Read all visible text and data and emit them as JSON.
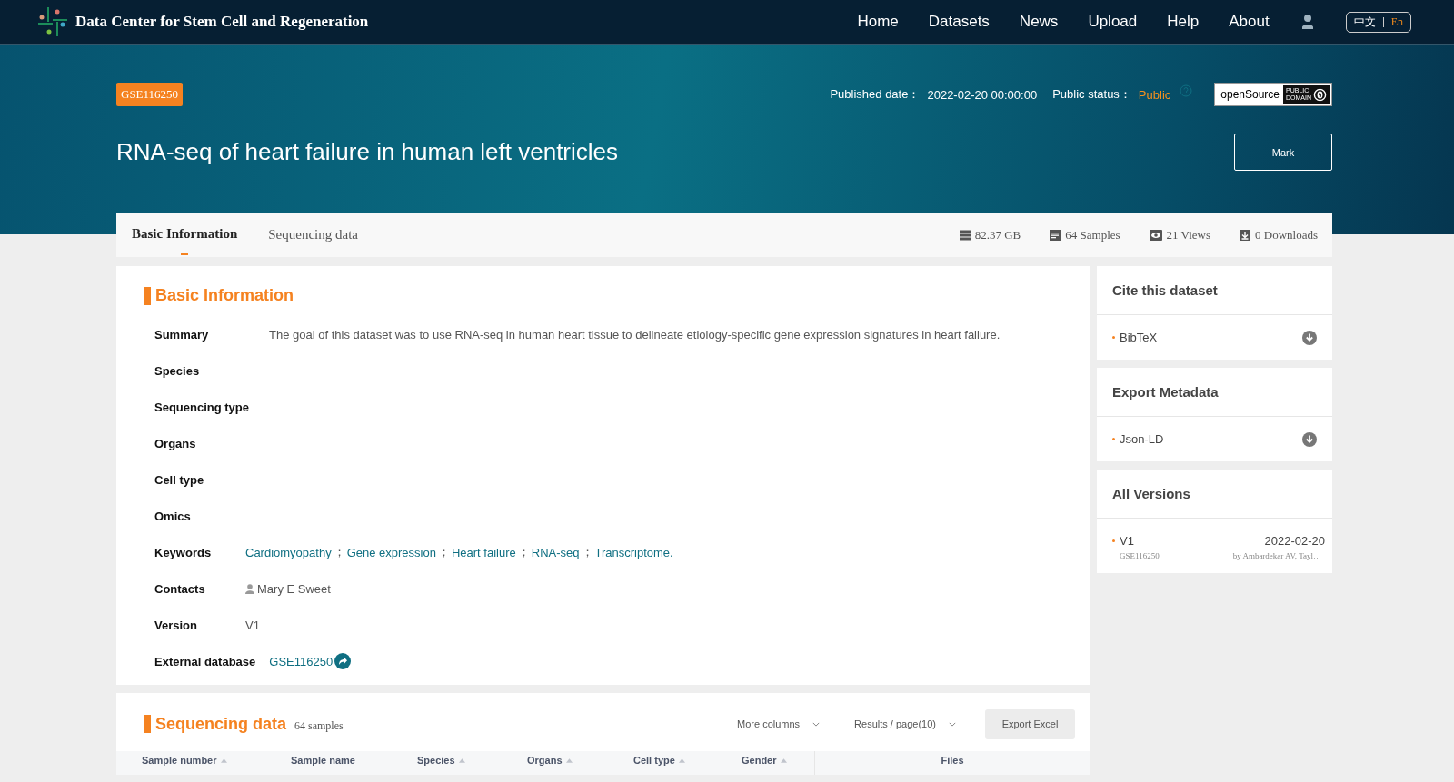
{
  "nav": {
    "site_title": "Data Center for Stem Cell and Regeneration",
    "links": [
      "Home",
      "Datasets",
      "News",
      "Upload",
      "Help",
      "About"
    ],
    "languages": [
      {
        "label": "中文",
        "selected": false
      },
      {
        "label": "En",
        "selected": true
      }
    ]
  },
  "header": {
    "accession": "GSE116250",
    "published_label": "Published date：",
    "published_date": "2022-02-20 00:00:00",
    "status_label": "Public status：",
    "status_value": "Public",
    "license": {
      "label": "openSource",
      "badge_lines": [
        "PUBLIC",
        "DOMAIN"
      ]
    },
    "title": "RNA-seq of heart failure in human left ventricles",
    "mark_button": "Mark"
  },
  "tabs": [
    {
      "label": "Basic Information",
      "selected": true
    },
    {
      "label": "Sequencing data",
      "selected": false
    }
  ],
  "stats": [
    {
      "kind": "size",
      "text": "82.37 GB"
    },
    {
      "kind": "samples",
      "text": "64 Samples"
    },
    {
      "kind": "views",
      "text": "21 Views"
    },
    {
      "kind": "downloads",
      "text": "0 Downloads"
    }
  ],
  "basic_information": {
    "heading": "Basic Information",
    "rows": [
      {
        "label": "Summary",
        "kind": "text",
        "value": "The goal of this dataset was to use RNA-seq in human heart tissue to delineate etiology-specific gene expression signatures in heart failure."
      },
      {
        "label": "Species",
        "kind": "text"
      },
      {
        "label": "Sequencing type",
        "kind": "text"
      },
      {
        "label": "Organs",
        "kind": "text"
      },
      {
        "label": "Cell type",
        "kind": "text"
      },
      {
        "label": "Omics",
        "kind": "text"
      },
      {
        "label": "Keywords",
        "kind": "keywords",
        "keywords": [
          "Cardiomyopathy",
          "Gene expression",
          "Heart failure",
          "RNA-seq",
          "Transcriptome."
        ],
        "separator": "；"
      },
      {
        "label": "Contacts",
        "kind": "contact",
        "value": "Mary E Sweet"
      },
      {
        "label": "Version",
        "kind": "text",
        "value": "V1"
      },
      {
        "label": "External database",
        "kind": "link",
        "value": "GSE116250"
      }
    ]
  },
  "sidebar": [
    {
      "kind": "downloads",
      "title": "Cite this dataset",
      "items": [
        {
          "label": "BibTeX"
        }
      ]
    },
    {
      "kind": "downloads",
      "title": "Export Metadata",
      "items": [
        {
          "label": "Json-LD"
        }
      ]
    },
    {
      "kind": "versions",
      "title": "All Versions",
      "items": [
        {
          "version": "V1",
          "date": "2022-02-20",
          "accession": "GSE116250",
          "authors": "by Ambardekar AV, Tayl…"
        }
      ]
    }
  ],
  "sequencing_data": {
    "heading": "Sequencing data",
    "count": "64 samples",
    "more_columns": "More columns",
    "results_per_page": "Results / page(10)",
    "export_button": "Export Excel",
    "columns": [
      {
        "label": "Sample number",
        "sortable": true
      },
      {
        "label": "Sample name",
        "sortable": false
      },
      {
        "label": "Species",
        "sortable": true
      },
      {
        "label": "Organs",
        "sortable": true
      },
      {
        "label": "Cell type",
        "sortable": true
      },
      {
        "label": "Gender",
        "sortable": true
      },
      {
        "label": "Files",
        "sortable": false
      }
    ]
  }
}
